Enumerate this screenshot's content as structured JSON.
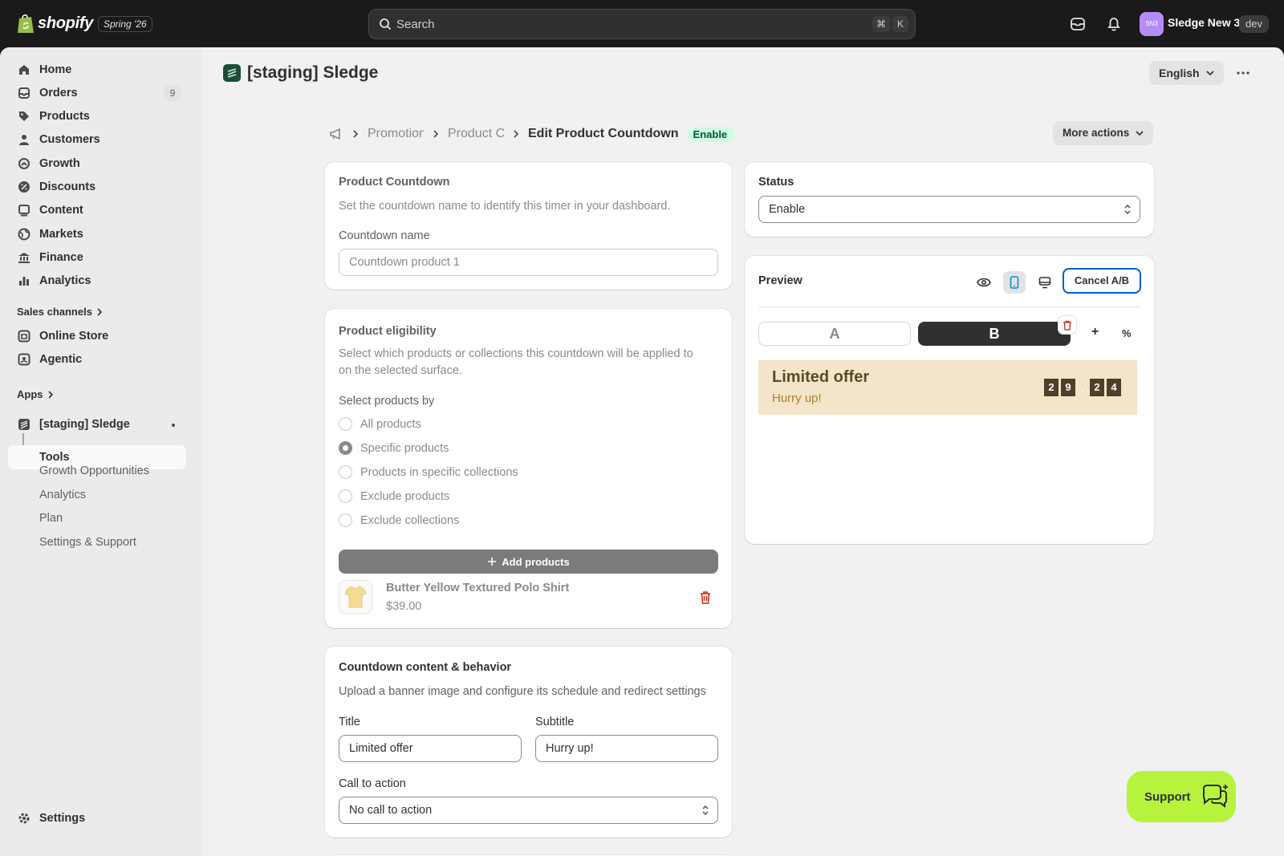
{
  "topbar": {
    "logo_text": "shopify",
    "edition": "Spring '26",
    "search_placeholder": "Search",
    "shortcut_cmd": "⌘",
    "shortcut_key": "K",
    "avatar_initials": "SN3",
    "store_name": "Sledge New 3",
    "env_badge": "dev"
  },
  "sidebar": {
    "items": [
      {
        "label": "Home",
        "icon": "home-icon"
      },
      {
        "label": "Orders",
        "icon": "orders-icon",
        "count": "9"
      },
      {
        "label": "Products",
        "icon": "tag-icon"
      },
      {
        "label": "Customers",
        "icon": "person-icon"
      },
      {
        "label": "Growth",
        "icon": "growth-icon"
      },
      {
        "label": "Discounts",
        "icon": "discount-icon"
      },
      {
        "label": "Content",
        "icon": "content-icon"
      },
      {
        "label": "Markets",
        "icon": "globe-icon"
      },
      {
        "label": "Finance",
        "icon": "bank-icon"
      },
      {
        "label": "Analytics",
        "icon": "bar-chart-icon"
      }
    ],
    "sales_channels_label": "Sales channels",
    "channels": [
      {
        "label": "Online Store",
        "icon": "store-icon"
      },
      {
        "label": "Agentic",
        "icon": "agentic-icon"
      }
    ],
    "apps_label": "Apps",
    "app_name": "[staging] Sledge",
    "app_sub_items": [
      "Tools",
      "Growth Opportunities",
      "Analytics",
      "Plan",
      "Settings & Support"
    ],
    "settings_label": "Settings"
  },
  "header": {
    "app_title": "[staging] Sledge",
    "language": "English"
  },
  "breadcrumb": {
    "items": [
      "Promotions",
      "Product Countdown"
    ],
    "current": "Edit Product Countdown",
    "status_badge": "Enable",
    "more_actions": "More actions"
  },
  "countdown_card": {
    "title": "Product Countdown",
    "help": "Set the countdown name to identify this timer in your dashboard.",
    "name_label": "Countdown name",
    "name_value": "Countdown product 1"
  },
  "eligibility_card": {
    "title": "Product eligibility",
    "help_line1": "Select which products or collections this countdown will be applied to",
    "help_line2": "on the selected surface.",
    "select_label": "Select products by",
    "options": [
      "All products",
      "Specific products",
      "Products in specific collections",
      "Exclude products",
      "Exclude collections"
    ],
    "selected_option": "Specific products",
    "add_button": "Add products",
    "product": {
      "name": "Butter Yellow Textured Polo Shirt",
      "price": "$39.00"
    }
  },
  "content_card": {
    "title": "Countdown content & behavior",
    "help": "Upload a banner image and configure its schedule and redirect settings",
    "title_label": "Title",
    "title_value": "Limited offer",
    "subtitle_label": "Subtitle",
    "subtitle_value": "Hurry up!",
    "cta_label": "Call to action",
    "cta_value": "No call to action"
  },
  "status_card": {
    "title": "Status",
    "value": "Enable"
  },
  "preview_card": {
    "title": "Preview",
    "cancel_ab": "Cancel A/B",
    "variant_a": "A",
    "variant_b": "B",
    "add_symbol": "+",
    "percent_symbol": "%",
    "banner_title": "Limited offer",
    "banner_subtitle": "Hurry up!",
    "digits": [
      "2",
      "9",
      "2",
      "4"
    ]
  },
  "support": {
    "label": "Support"
  },
  "colors": {
    "topbar": "#1a1a1a",
    "status_green_bg": "#cdfee1",
    "support_bg": "#b7f33c",
    "focus_blue": "#005bd3",
    "banner_bg": "#f3e5c9"
  }
}
